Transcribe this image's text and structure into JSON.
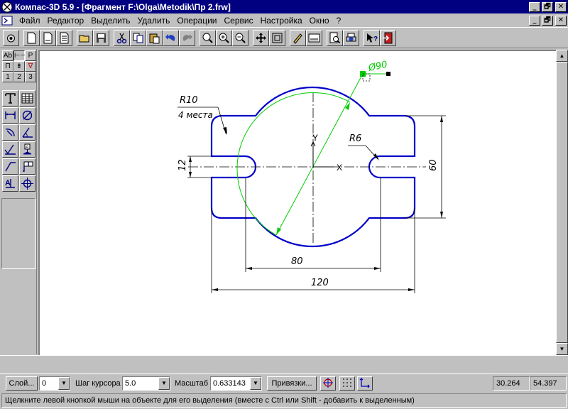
{
  "window": {
    "title": "Компас-3D 5.9 - [Фрагмент F:\\Olga\\Metodik\\Пр 2.frw]",
    "controls": {
      "minimize": "_",
      "restore": "🗗",
      "close": "✕"
    }
  },
  "menu": {
    "items": [
      "Файл",
      "Редактор",
      "Выделить",
      "Удалить",
      "Операции",
      "Сервис",
      "Настройка",
      "Окно",
      "?"
    ]
  },
  "toolbar": {
    "icons": [
      "snapshot-icon",
      "new-document-icon",
      "new-sheet-icon",
      "new-text-icon",
      "open-folder-icon",
      "save-icon",
      "cut-icon",
      "copy-icon",
      "paste-icon",
      "undo-icon",
      "redo-icon",
      "zoom-window-icon",
      "zoom-in-icon",
      "zoom-out-icon",
      "pan-icon",
      "zoom-fit-icon",
      "refresh-icon",
      "properties-icon",
      "print-preview-icon",
      "print-icon",
      "context-help-icon",
      "exit-icon"
    ]
  },
  "left_panel": {
    "tabs_row1": [
      "Ab",
      "⊢⊣",
      "P"
    ],
    "tabs_row2": [
      "П",
      "⇟",
      "∇"
    ],
    "tabs_row3": [
      "1",
      "2",
      "3"
    ]
  },
  "drawing": {
    "dim_diameter": "Ø90",
    "dim_radius_large": "R10",
    "dim_radius_note": "4 места",
    "dim_radius_small": "R6",
    "dim_slot": "12",
    "dim_height": "60",
    "dim_80": "80",
    "dim_120": "120",
    "axis_y": "Y",
    "axis_x": "X"
  },
  "params_bar": {
    "layer_button": "Слой...",
    "layer_value": "0",
    "step_label": "Шаг курсора",
    "step_value": "5.0",
    "scale_label": "Масштаб",
    "scale_value": "0.633143",
    "snaps_button": "Привязки...",
    "coord_x": "30.264",
    "coord_y": "54.397"
  },
  "status": {
    "hint": "Щелкните левой кнопкой мыши на объекте для его выделения (вместе с Ctrl или Shift - добавить к выделенным)"
  },
  "colors": {
    "titlebar": "#000080",
    "contour": "#0000c8",
    "selected": "#00cc00"
  }
}
